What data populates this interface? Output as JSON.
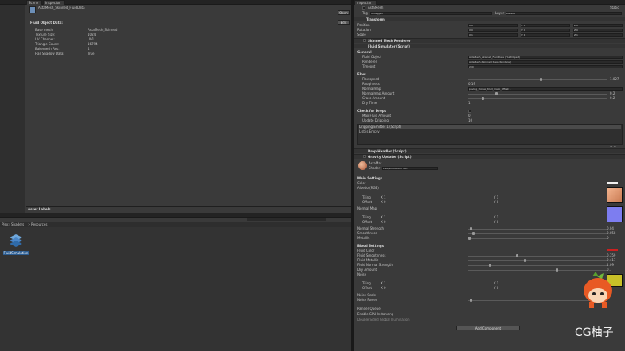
{
  "left_tabs": [
    "Scene",
    "Inspector"
  ],
  "left_asset": {
    "name": "AstaMesh_Skinned_FluidData",
    "lock_label": "Open"
  },
  "fluid_data": {
    "title": "Fluid Object Data:",
    "edit_label": "Edit",
    "rows": [
      [
        "Base mesh:",
        "AstaMesh_Skinned"
      ],
      [
        "Texture Size:",
        "1024"
      ],
      [
        "UV Channel:",
        "UV1"
      ],
      [
        "Triangle Count:",
        "16794"
      ],
      [
        "Bakemesh Res:",
        "4"
      ],
      [
        "Has Shadow Data:",
        "True"
      ]
    ]
  },
  "asset_labels": "Asset Labels",
  "breadcrumb": [
    "Plex",
    "Shaders",
    "Resources"
  ],
  "project_item": "FluidSimulation",
  "right_tab": "Inspector",
  "gameobject": {
    "name": "AstaMesh",
    "static_label": "Static",
    "tag_label": "Tag",
    "tag_value": "Untagged",
    "layer_label": "Layer",
    "layer_value": "Default"
  },
  "transform": {
    "title": "Transform",
    "rows": [
      {
        "label": "Position",
        "x": "X 0",
        "y": "Y 0",
        "z": "Z 0"
      },
      {
        "label": "Rotation",
        "x": "X 0",
        "y": "Y 0",
        "z": "Z 0"
      },
      {
        "label": "Scale",
        "x": "X 1",
        "y": "Y 1",
        "z": "Z 1"
      }
    ]
  },
  "smr_title": "Skinned Mesh Renderer",
  "fluid_sim": {
    "title": "Fluid Simulator (Script)",
    "general": "General",
    "general_rows": [
      [
        "Fluid Object",
        "AstaMesh_Skinned_FluidData (FluidObject)"
      ],
      [
        "Renderer",
        "AstaMesh (Skinned Mesh Renderer)"
      ],
      [
        "Timeout",
        "200"
      ]
    ],
    "flow": "Flow",
    "flow_rows": [
      [
        "Flowspeed",
        "1.027"
      ],
      [
        "Roughness",
        "0.19"
      ],
      [
        "Normalmap",
        "paving_stones_tiled_mask_Offset 1"
      ],
      [
        "Normalmap Amount",
        "0.2"
      ],
      [
        "Grass Amount",
        "0.2"
      ],
      [
        "Dry Time",
        "1"
      ]
    ],
    "check_drops": "Check for Drops",
    "drops_rows": [
      [
        "Max Fluid Amount",
        "0"
      ],
      [
        "Update Dripping",
        "10"
      ]
    ],
    "list_item": "Dripping Emitter 1 (Script)",
    "list_empty": "List is Empty"
  },
  "drop_handler": "Drop Handler (Script)",
  "gravity_updater": "Gravity Updater (Script)",
  "material": {
    "name": "AstaMat",
    "shader_label": "Shader",
    "shader_value": "Plex/SimulationFluid"
  },
  "main_settings": {
    "title": "Main Settings",
    "rows": [
      [
        "Color",
        ""
      ],
      [
        "Albedo (RGB)",
        ""
      ],
      [
        "Tiling",
        "X 1",
        "Y 1"
      ],
      [
        "Offset",
        "X 0",
        "Y 0"
      ],
      [
        "Normal Map",
        ""
      ],
      [
        "Tiling",
        "X 1",
        "Y 1"
      ],
      [
        "Offset",
        "X 0",
        "Y 0"
      ],
      [
        "Normal Strength",
        "0.04"
      ],
      [
        "Smoothness",
        "0.058"
      ],
      [
        "Metallic",
        "0"
      ]
    ]
  },
  "blood_settings": {
    "title": "Blood Settings",
    "rows": [
      [
        "Fluid Color",
        ""
      ],
      [
        "Fluid Smoothness",
        "0.359"
      ],
      [
        "Fluid Metallic",
        "0.417"
      ],
      [
        "Fluid Normal Strength",
        "1.09"
      ],
      [
        "Dry Amount",
        "0.7"
      ],
      [
        "Noise",
        ""
      ],
      [
        "Tiling",
        "X 1",
        "Y 1"
      ],
      [
        "Offset",
        "X 0",
        "Y 0"
      ],
      [
        "Noise Scale",
        ""
      ],
      [
        "Noise Power",
        ""
      ]
    ]
  },
  "render_queue": "Render Queue",
  "gpu_instancing": "Enable GPU Instancing",
  "double_sided": "Double Sided Global Illumination",
  "add_component": "Add Component",
  "watermark": "CG柚子",
  "colors": {
    "panel": "#3a3a3a",
    "dark": "#232323",
    "albedo": "#e8a07a",
    "normal": "#7d7df0",
    "fluid": "#cc2020",
    "noise": "#c8c028"
  }
}
